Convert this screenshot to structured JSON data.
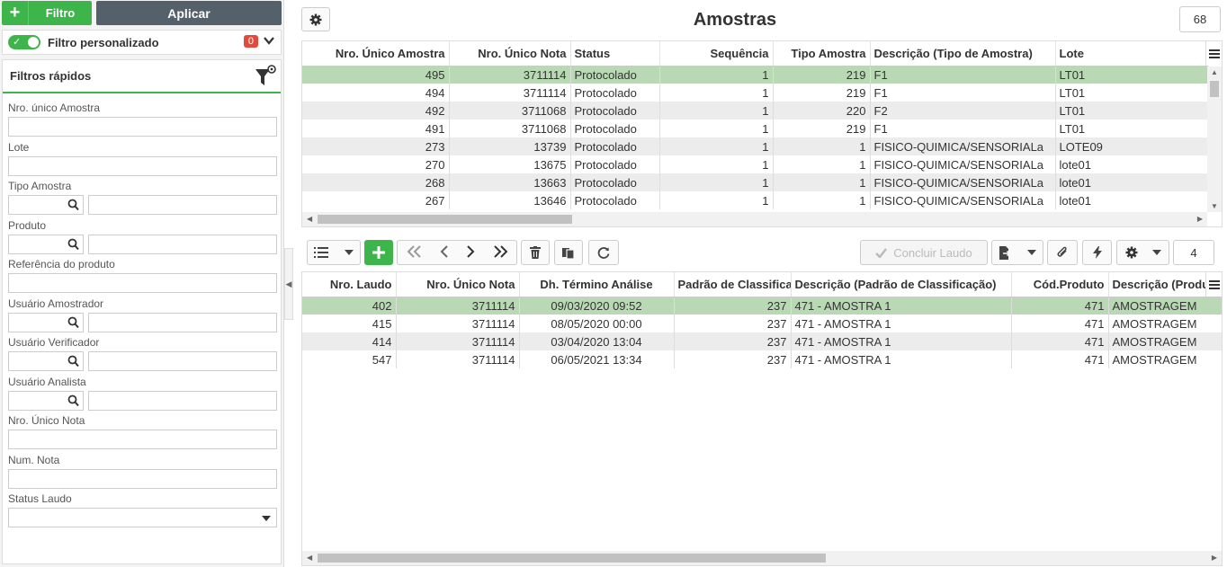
{
  "left": {
    "filter_button": "Filtro",
    "apply_button": "Aplicar",
    "custom_filter_label": "Filtro personalizado",
    "custom_filter_count": "0",
    "quick_filters_title": "Filtros rápidos",
    "fields": {
      "nro_unico_amostra": "Nro. único Amostra",
      "lote": "Lote",
      "tipo_amostra": "Tipo Amostra",
      "produto": "Produto",
      "referencia_produto": "Referência do produto",
      "usuario_amostrador": "Usuário Amostrador",
      "usuario_verificador": "Usuário Verificador",
      "usuario_analista": "Usuário Analista",
      "nro_unico_nota": "Nro. Único Nota",
      "num_nota": "Num. Nota",
      "status_laudo": "Status Laudo"
    }
  },
  "main": {
    "title": "Amostras",
    "record_count": "68",
    "headers": [
      "Nro. Único Amostra",
      "Nro. Único Nota",
      "Status",
      "Sequência",
      "Tipo Amostra",
      "Descrição (Tipo de Amostra)",
      "Lote"
    ],
    "rows": [
      [
        "495",
        "3711114",
        "Protocolado",
        "1",
        "219",
        "F1",
        "LT01"
      ],
      [
        "494",
        "3711114",
        "Protocolado",
        "1",
        "219",
        "F1",
        "LT01"
      ],
      [
        "492",
        "3711068",
        "Protocolado",
        "1",
        "220",
        "F2",
        "LT01"
      ],
      [
        "491",
        "3711068",
        "Protocolado",
        "1",
        "219",
        "F1",
        "LT01"
      ],
      [
        "273",
        "13739",
        "Protocolado",
        "1",
        "1",
        "FISICO-QUIMICA/SENSORIALa",
        "LOTE09"
      ],
      [
        "270",
        "13675",
        "Protocolado",
        "1",
        "1",
        "FISICO-QUIMICA/SENSORIALa",
        "lote01"
      ],
      [
        "268",
        "13663",
        "Protocolado",
        "1",
        "1",
        "FISICO-QUIMICA/SENSORIALa",
        "lote01"
      ],
      [
        "267",
        "13646",
        "Protocolado",
        "1",
        "1",
        "FISICO-QUIMICA/SENSORIALa",
        "lote01"
      ]
    ]
  },
  "detail": {
    "conclude_button": "Concluir Laudo",
    "record_count": "4",
    "headers": [
      "Nro. Laudo",
      "Nro. Único Nota",
      "Dh. Término Análise",
      "Padrão de Classificação",
      "Descrição (Padrão de Classificação)",
      "Cód.Produto",
      "Descrição (Produto)"
    ],
    "rows": [
      [
        "402",
        "3711114",
        "09/03/2020 09:52",
        "237",
        "471 - AMOSTRA 1",
        "471",
        "AMOSTRAGEM"
      ],
      [
        "415",
        "3711114",
        "08/05/2020 00:00",
        "237",
        "471 - AMOSTRA 1",
        "471",
        "AMOSTRAGEM"
      ],
      [
        "414",
        "3711114",
        "03/04/2020 13:04",
        "237",
        "471 - AMOSTRA 1",
        "471",
        "AMOSTRAGEM"
      ],
      [
        "547",
        "3711114",
        "06/05/2021 13:34",
        "237",
        "471 - AMOSTRA 1",
        "471",
        "AMOSTRAGEM"
      ]
    ]
  },
  "colors": {
    "accent": "#3eb54a",
    "selected_row": "#b8d9b4",
    "dark_button": "#54606a",
    "badge": "#e24b3b"
  }
}
